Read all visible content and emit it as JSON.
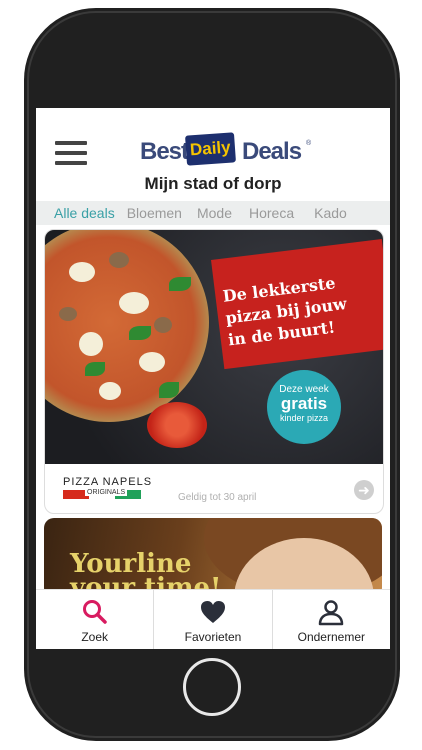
{
  "header": {
    "logo_best": "Best",
    "logo_daily": "Daily",
    "logo_deals": "Deals",
    "logo_reg": "®",
    "city": "Mijn stad of dorp"
  },
  "tabs": [
    {
      "label": "Alle deals",
      "active": true
    },
    {
      "label": "Bloemen",
      "active": false
    },
    {
      "label": "Mode",
      "active": false
    },
    {
      "label": "Horeca",
      "active": false
    },
    {
      "label": "Kado",
      "active": false
    }
  ],
  "deal1": {
    "banner_line1": "De lekkerste",
    "banner_line2": "pizza bij jouw",
    "banner_line3": "in de buurt!",
    "badge_line1": "Deze week",
    "badge_line2": "gratis",
    "badge_line3": "kinder pizza",
    "brand": "PIZZA NAPELS",
    "brand_sub": "ORIGINALS",
    "valid": "Geldig tot 30 april",
    "arrow_icon": "arrow-right-icon"
  },
  "deal2": {
    "line1": "Yourline",
    "line2": "your time!"
  },
  "nav": [
    {
      "label": "Zoek",
      "icon": "search-icon"
    },
    {
      "label": "Favorieten",
      "icon": "heart-icon"
    },
    {
      "label": "Ondernemer",
      "icon": "user-icon"
    }
  ],
  "colors": {
    "accent": "#3aa0a6",
    "search": "#d81b60",
    "banner_red": "#c7221e",
    "badge_teal": "#2ba9b5"
  }
}
